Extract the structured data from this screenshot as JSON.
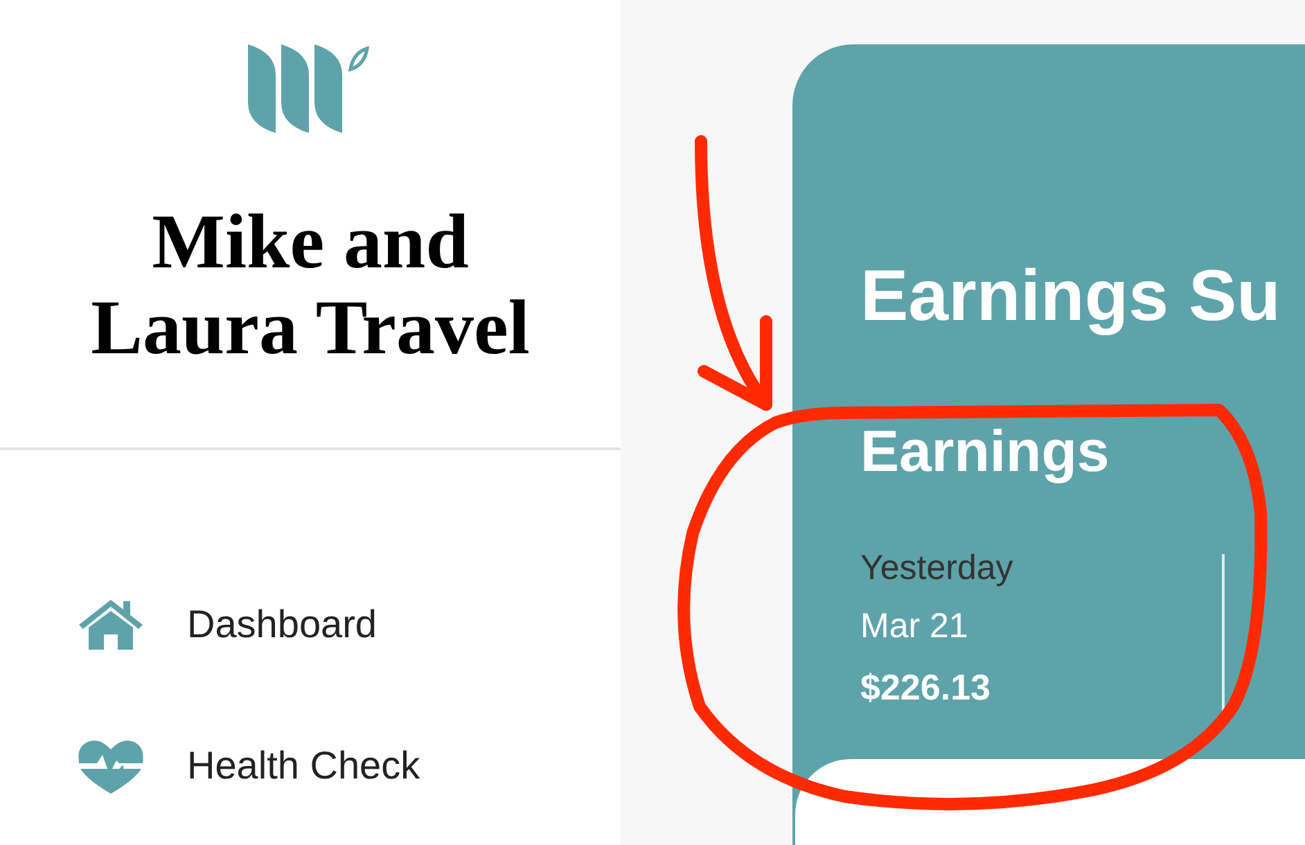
{
  "sidebar": {
    "brand": "Mike and Laura Travel",
    "items": [
      {
        "label": "Dashboard",
        "kind": "home",
        "selected": false
      },
      {
        "label": "Health Check",
        "kind": "health",
        "selected": false
      }
    ]
  },
  "summary": {
    "title": "Earnings Su",
    "section": "Earnings",
    "period": "Yesterday",
    "date": "Mar 21",
    "amount": "$226.13"
  }
}
